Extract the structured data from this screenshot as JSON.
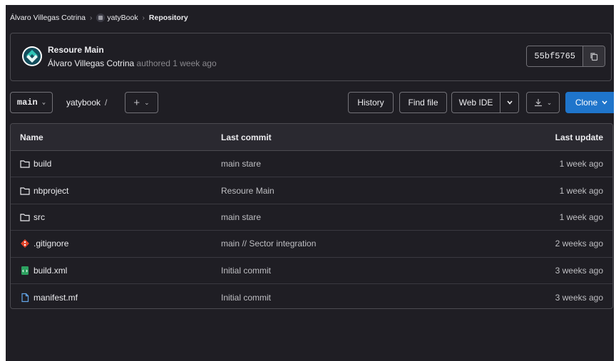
{
  "breadcrumb": {
    "owner": "Álvaro Villegas Cotrina",
    "project": "yatyBook",
    "current": "Repository",
    "sep": "›"
  },
  "commit": {
    "title": "Resoure Main",
    "author": "Álvaro Villegas Cotrina",
    "action": "authored",
    "time": "1 week ago",
    "sha": "55bf5765"
  },
  "toolbar": {
    "branch": "main",
    "path": "yatybook",
    "path_sep": "/",
    "add_label": "+",
    "history": "History",
    "find_file": "Find file",
    "web_ide": "Web IDE",
    "clone": "Clone"
  },
  "table": {
    "headers": {
      "name": "Name",
      "commit": "Last commit",
      "update": "Last update"
    },
    "rows": [
      {
        "name": "build",
        "icon": "folder-icon",
        "commit": "main stare",
        "update": "1 week ago"
      },
      {
        "name": "nbproject",
        "icon": "folder-icon",
        "commit": "Resoure Main",
        "update": "1 week ago"
      },
      {
        "name": "src",
        "icon": "folder-icon",
        "commit": "main stare",
        "update": "1 week ago"
      },
      {
        "name": ".gitignore",
        "icon": "git-icon",
        "commit": "main // Sector integration",
        "update": "2 weeks ago"
      },
      {
        "name": "build.xml",
        "icon": "xml-file-icon",
        "commit": "Initial commit",
        "update": "3 weeks ago"
      },
      {
        "name": "manifest.mf",
        "icon": "file-icon",
        "commit": "Initial commit",
        "update": "3 weeks ago"
      }
    ]
  },
  "colors": {
    "background": "#1f1e24",
    "header_bg": "#2a2930",
    "border": "#4c4b51",
    "primary": "#1f75cb",
    "git_icon": "#e24329",
    "xml_icon": "#2da160",
    "file_icon": "#63a6e9"
  }
}
